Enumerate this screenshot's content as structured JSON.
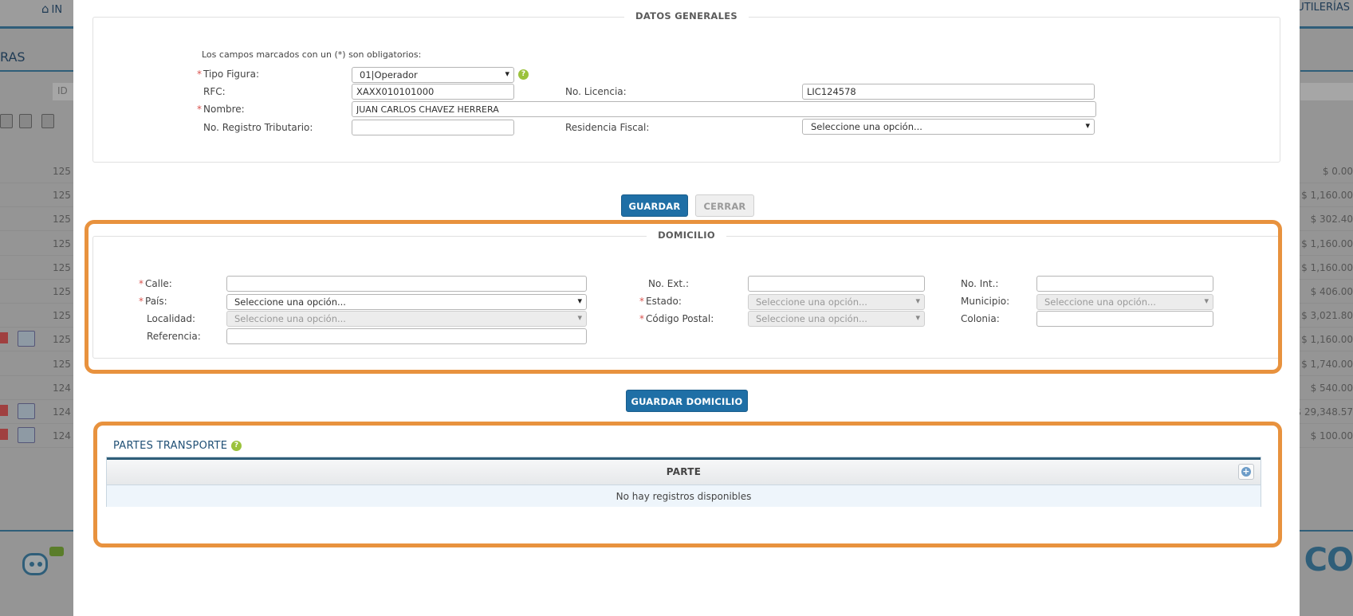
{
  "background": {
    "nav_home_label": "IN",
    "nav_right_label": "UTILERÍAS",
    "page_title": "RAS",
    "column_header": "ID",
    "rows": [
      {
        "id": "125",
        "amount": "$ 0.00",
        "icons": false
      },
      {
        "id": "125",
        "amount": "$ 1,160.00",
        "icons": false
      },
      {
        "id": "125",
        "amount": "$ 302.40",
        "icons": false
      },
      {
        "id": "125",
        "amount": "$ 1,160.00",
        "icons": false
      },
      {
        "id": "125",
        "amount": "$ 1,160.00",
        "icons": false
      },
      {
        "id": "125",
        "amount": "$ 406.00",
        "icons": false
      },
      {
        "id": "125",
        "amount": "$ 3,021.80",
        "icons": false
      },
      {
        "id": "125",
        "amount": "$ 1,160.00",
        "icons": true
      },
      {
        "id": "125",
        "amount": "$ 1,740.00",
        "icons": false
      },
      {
        "id": "124",
        "amount": "$ 540.00",
        "icons": false
      },
      {
        "id": "124",
        "amount": "$ 29,348.57",
        "icons": true
      },
      {
        "id": "124",
        "amount": "$ 100.00",
        "icons": true
      }
    ],
    "brand_text": "CO",
    "robot_badge": "?"
  },
  "datos_generales": {
    "legend": "DATOS GENERALES",
    "required_note": "Los campos marcados con un (*) son obligatorios:",
    "required_mark": "*",
    "tipo_figura_label": "Tipo Figura:",
    "tipo_figura_value": "01|Operador",
    "help_icon": "?",
    "rfc_label": "RFC:",
    "rfc_value": "XAXX010101000",
    "licencia_label": "No. Licencia:",
    "licencia_value": "LIC124578",
    "nombre_label": "Nombre:",
    "nombre_value": "JUAN CARLOS CHAVEZ HERRERA",
    "registro_label": "No. Registro Tributario:",
    "registro_value": "",
    "residencia_label": "Residencia Fiscal:",
    "residencia_value": "Seleccione una opción..."
  },
  "buttons": {
    "guardar": "GUARDAR",
    "cerrar": "CERRAR",
    "guardar_domicilio": "GUARDAR DOMICILIO"
  },
  "domicilio": {
    "legend": "DOMICILIO",
    "calle_label": "Calle:",
    "calle_value": "",
    "no_ext_label": "No. Ext.:",
    "no_ext_value": "",
    "no_int_label": "No. Int.:",
    "no_int_value": "",
    "pais_label": "País:",
    "pais_value": "Seleccione una opción...",
    "estado_label": "Estado:",
    "estado_value": "Seleccione una opción...",
    "municipio_label": "Municipio:",
    "municipio_value": "Seleccione una opción...",
    "localidad_label": "Localidad:",
    "localidad_value": "Seleccione una opción...",
    "cp_label": "Código Postal:",
    "cp_value": "Seleccione una opción...",
    "colonia_label": "Colonia:",
    "colonia_value": "",
    "referencia_label": "Referencia:",
    "referencia_value": ""
  },
  "partes_transporte": {
    "title": "PARTES TRANSPORTE",
    "column_header": "PARTE",
    "empty_message": "No hay registros disponibles",
    "add_icon": "+"
  },
  "colors": {
    "primary": "#1f6fa6",
    "highlight": "#e8923e",
    "required": "#d9534f",
    "help": "#9bc23c"
  }
}
